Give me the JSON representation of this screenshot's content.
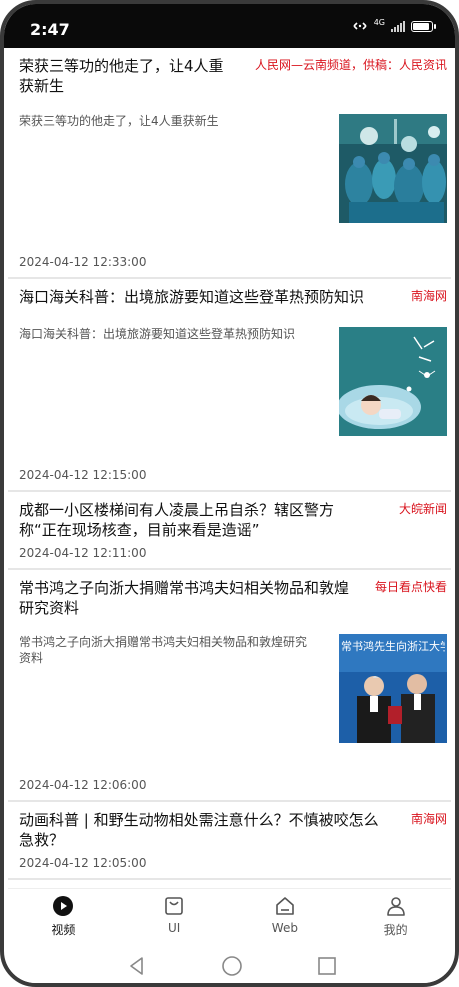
{
  "status_bar": {
    "time": "2:47",
    "network": "4G"
  },
  "feed": [
    {
      "title": "荣获三等功的他走了，让4人重获新生",
      "source": "人民网—云南频道，供稿：人民资讯",
      "summary": "荣获三等功的他走了，让4人重获新生",
      "time": "2024-04-12 12:33:00",
      "image": "surgery-operating-room-photo"
    },
    {
      "title": "海口海关科普：出境旅游要知道这些登革热预防知识",
      "source": "南海网",
      "summary": "海口海关科普：出境旅游要知道这些登革热预防知识",
      "time": "2024-04-12 12:15:00",
      "image": "mosquito-sleeping-child-illustration"
    },
    {
      "title": "成都一小区楼梯间有人凌晨上吊自杀？辖区警方称“正在现场核查，目前来看是造谣”",
      "source": "大皖新闻",
      "time": "2024-04-12 12:11:00"
    },
    {
      "title": "常书鸿之子向浙大捐赠常书鸿夫妇相关物品和敦煌研究资料",
      "source": "每日看点快看",
      "summary": "常书鸿之子向浙大捐赠常书鸿夫妇相关物品和敦煌研究资料",
      "time": "2024-04-12 12:06:00",
      "image": "donation-ceremony-photo",
      "image_caption": "常书鸿先生向浙江大学捐赠仪式"
    },
    {
      "title": "动画科普 | 和野生动物相处需注意什么？不慎被咬怎么急救？",
      "source": "南海网",
      "time": "2024-04-12 12:05:00"
    }
  ],
  "tabs": [
    {
      "label": "视频",
      "icon": "play-circle-icon",
      "active": true
    },
    {
      "label": "UI",
      "icon": "shopping-bag-icon",
      "active": false
    },
    {
      "label": "Web",
      "icon": "home-icon",
      "active": false
    },
    {
      "label": "我的",
      "icon": "person-icon",
      "active": false
    }
  ],
  "colors": {
    "source_red": "#d9141e",
    "status_bar": "#0a0a0a",
    "divider": "#e6e6e6"
  }
}
